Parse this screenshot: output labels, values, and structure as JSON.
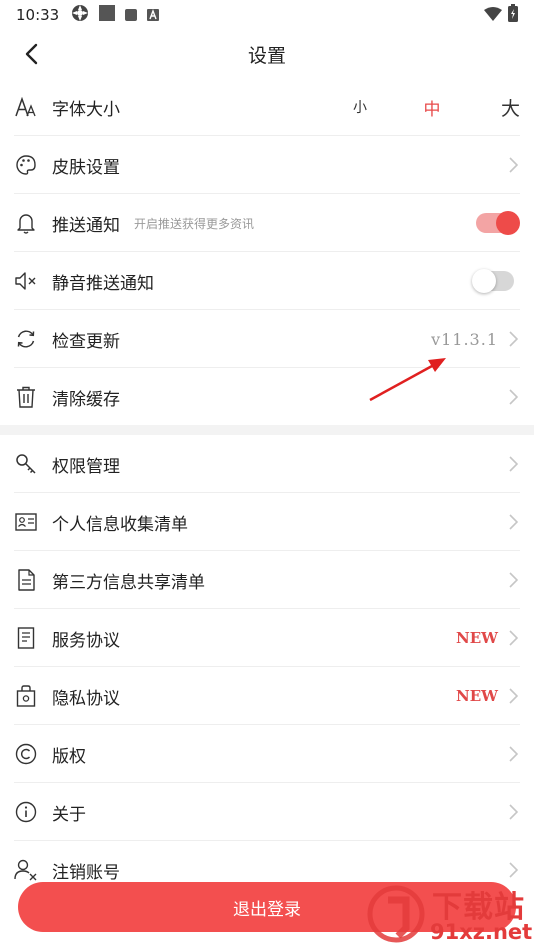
{
  "status_bar": {
    "time": "10:33"
  },
  "header": {
    "title": "设置"
  },
  "group1": [
    {
      "id": "font-size",
      "label": "字体大小",
      "icon": "font-size-icon",
      "options": [
        "小",
        "中",
        "大"
      ],
      "selected": "中"
    },
    {
      "id": "skin",
      "label": "皮肤设置",
      "icon": "palette-icon"
    },
    {
      "id": "push",
      "label": "推送通知",
      "icon": "bell-icon",
      "sub": "开启推送获得更多资讯",
      "toggle": true
    },
    {
      "id": "silent-push",
      "label": "静音推送通知",
      "icon": "speaker-mute-icon",
      "toggle": false
    },
    {
      "id": "update",
      "label": "检查更新",
      "icon": "refresh-icon",
      "value": "v11.3.1"
    },
    {
      "id": "cache",
      "label": "清除缓存",
      "icon": "trash-icon"
    }
  ],
  "group2": [
    {
      "id": "permissions",
      "label": "权限管理",
      "icon": "key-icon"
    },
    {
      "id": "personal-info",
      "label": "个人信息收集清单",
      "icon": "id-card-icon"
    },
    {
      "id": "third-party",
      "label": "第三方信息共享清单",
      "icon": "document-icon"
    },
    {
      "id": "service",
      "label": "服务协议",
      "icon": "list-document-icon",
      "badge": "NEW"
    },
    {
      "id": "privacy",
      "label": "隐私协议",
      "icon": "lock-icon",
      "badge": "NEW"
    },
    {
      "id": "copyright",
      "label": "版权",
      "icon": "copyright-icon"
    },
    {
      "id": "about",
      "label": "关于",
      "icon": "info-icon"
    },
    {
      "id": "deregister",
      "label": "注销账号",
      "icon": "user-remove-icon"
    }
  ],
  "logout": {
    "label": "退出登录"
  },
  "watermark": {
    "brand": "下载站",
    "site": "91xz.net"
  },
  "colors": {
    "accent": "#ee4b49",
    "button": "#f34f4f",
    "divider": "#eeeeee"
  }
}
